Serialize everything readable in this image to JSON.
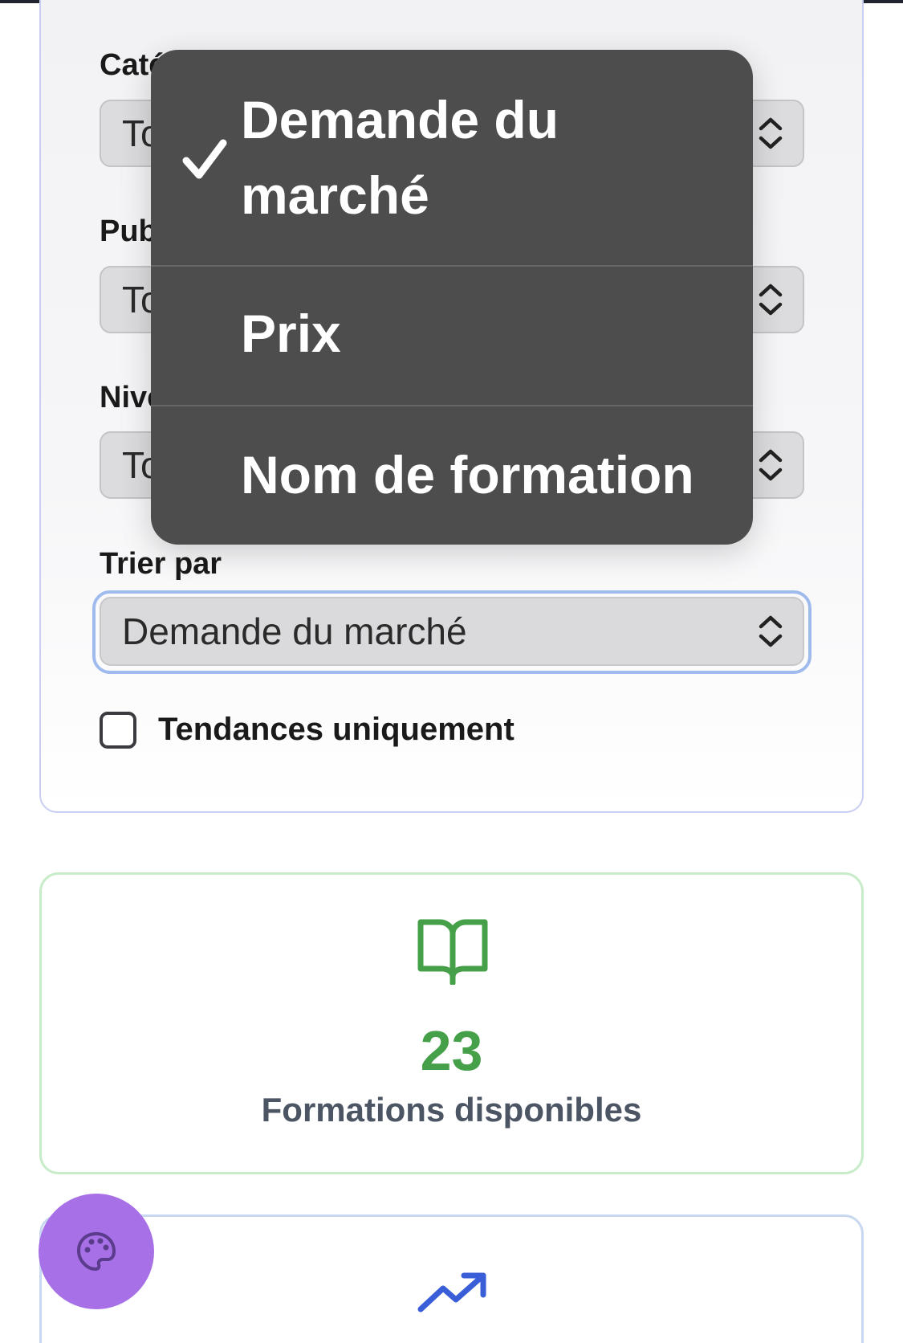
{
  "filters": {
    "fields": [
      {
        "label": "Catégorie",
        "value": "Toutes"
      },
      {
        "label": "Public",
        "value": "Tous"
      },
      {
        "label": "Niveau",
        "value": "Tous"
      }
    ],
    "sort": {
      "label": "Trier par",
      "value": "Demande du marché"
    },
    "trending_only": {
      "label": "Tendances uniquement",
      "checked": false
    }
  },
  "sort_menu": {
    "options": [
      {
        "label": "Demande du marché",
        "selected": true
      },
      {
        "label": "Prix",
        "selected": false
      },
      {
        "label": "Nom de formation",
        "selected": false
      }
    ]
  },
  "stats": {
    "formations": {
      "value": "23",
      "label": "Formations disponibles",
      "icon": "book-open-icon",
      "color": "#46a04a"
    },
    "trend": {
      "icon": "trending-up-icon",
      "color": "#3a5ed8"
    }
  },
  "fab": {
    "icon": "palette-icon",
    "color": "#a770e6"
  }
}
